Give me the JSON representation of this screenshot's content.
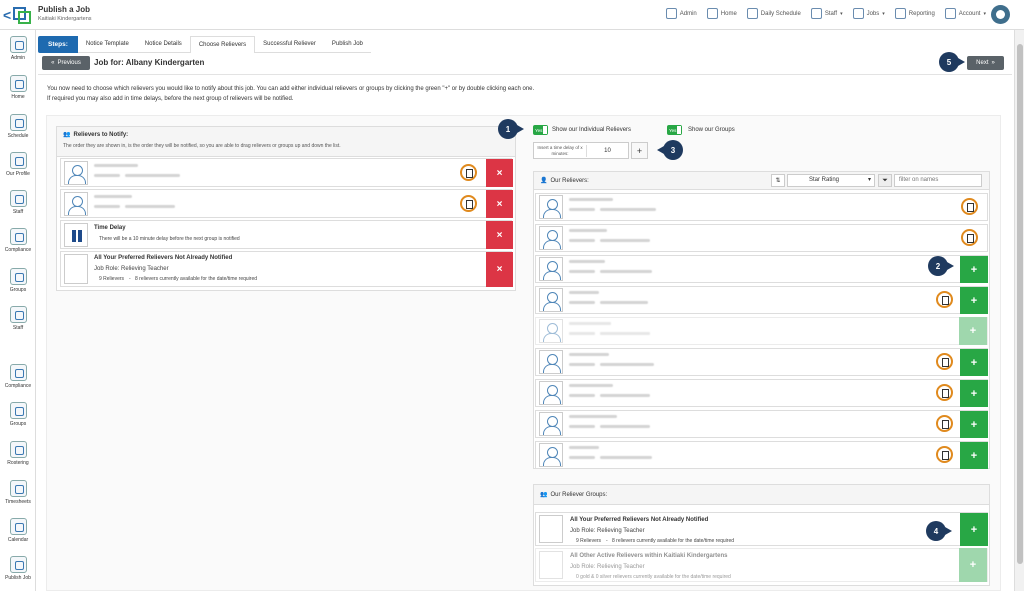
{
  "app": {
    "title": "Publish a Job",
    "subtitle": "Kaitiaki Kindergartens"
  },
  "topnav": [
    {
      "label": "Admin",
      "caret": false
    },
    {
      "label": "Home",
      "caret": false
    },
    {
      "label": "Daily Schedule",
      "caret": false
    },
    {
      "label": "Staff",
      "caret": true
    },
    {
      "label": "Jobs",
      "caret": true
    },
    {
      "label": "Reporting",
      "caret": false
    },
    {
      "label": "Account",
      "caret": true
    }
  ],
  "sidebar": [
    "Admin",
    "Home",
    "Schedule",
    "Our Profile",
    "Staff",
    "Compliance",
    "Groups",
    "Staff",
    "Compliance",
    "Groups",
    "Rostering",
    "Timesheets",
    "Calendar",
    "Publish Job"
  ],
  "steps": {
    "title": "Steps:",
    "items": [
      "Notice Template",
      "Notice Details",
      "Choose Relievers",
      "Successful Reliever",
      "Publish Job"
    ],
    "active_index": 2
  },
  "nav": {
    "previous": "Previous",
    "next": "Next",
    "job_for": "Job for: Albany Kindergarten"
  },
  "instructions": [
    "You now need to choose which relievers you would like to notify about this job. You can add either individual relievers or groups by clicking the green \"+\" or by double clicking each one.",
    "If required you may also add in time delays, before the next group of relievers will be notified."
  ],
  "notify_panel": {
    "title": "Relievers to Notify:",
    "note": "The order they are shown in, is the order they will be notified, so you are able to drag relievers or groups up and down the list.",
    "time_delay": {
      "title": "Time Delay",
      "text": "There will be a 10 minute delay before the next group is notified"
    },
    "group": {
      "title": "All Your Preferred Relievers Not Already Notified",
      "role": "Job Role: Relieving Teacher",
      "count": "9 Relievers",
      "available": "8 relievers currently available for the date/time required"
    }
  },
  "toggles": {
    "individual": {
      "state": "Yes",
      "label": "Show our Individual Relievers"
    },
    "groups": {
      "state": "Yes",
      "label": "Show our Groups"
    }
  },
  "delay": {
    "label": "Insert a time delay of x minutes:",
    "value": "10",
    "add": "+"
  },
  "relievers_panel": {
    "title": "Our Relievers:",
    "sort_value": "Star Rating",
    "filter_placeholder": "filter on names"
  },
  "groups_panel": {
    "title": "Our Reliever Groups:",
    "groups": [
      {
        "title": "All Your Preferred Relievers Not Already Notified",
        "role": "Job Role: Relieving Teacher",
        "count": "9 Relievers",
        "available": "8 relievers currently available for the date/time required"
      },
      {
        "title": "All Other Active Relievers within Kaitiaki Kindergartens",
        "role": "Job Role: Relieving Teacher",
        "count": "",
        "available": "0 gold & 0 silver relievers currently available for the date/time required"
      }
    ]
  },
  "callouts": [
    "1",
    "2",
    "3",
    "4",
    "5"
  ],
  "icons": {
    "add": "+",
    "remove": "×",
    "prev": "«",
    "next": "»",
    "back": "<"
  },
  "colors": {
    "primary": "#1e6ab0",
    "add": "#28a745",
    "remove": "#dc3545",
    "callout": "#1f3a5f",
    "no_phone": "#e08a1e"
  }
}
